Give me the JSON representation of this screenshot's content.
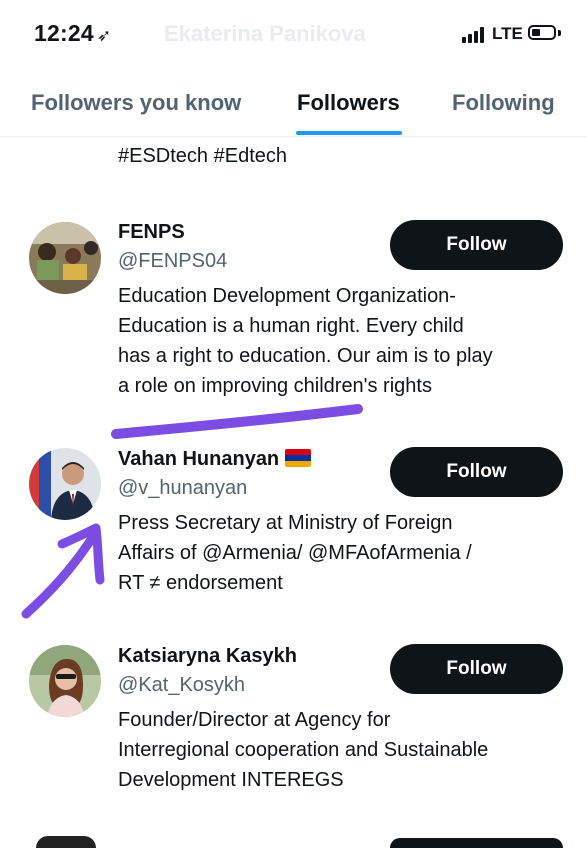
{
  "status_bar": {
    "time": "12:24",
    "location_glyph": "➶",
    "network": "LTE",
    "header_faded_title": "Ekaterina Panikova"
  },
  "tabs": [
    {
      "label": "Followers you know",
      "active": false
    },
    {
      "label": "Followers",
      "active": true
    },
    {
      "label": "Following",
      "active": false
    }
  ],
  "accent_color": "#1d9bf0",
  "annotation_color": "#7b4de3",
  "partial_bio": "#ESDtech #Edtech",
  "users": [
    {
      "name": "FENPS",
      "handle": "@FENPS04",
      "button": "Follow",
      "bio_lines": [
        "Education Development Organization-",
        "Education is a human right. Every child",
        "has a right to education. Our aim is to play",
        "a role on improving children's rights"
      ]
    },
    {
      "name": "Vahan Hunanyan",
      "flag": "armenia-flag",
      "handle": "@v_hunanyan",
      "button": "Follow",
      "bio_lines": [
        "Press Secretary at Ministry of Foreign",
        "Affairs of @Armenia/ @MFAofArmenia /",
        "RT ≠ endorsement"
      ]
    },
    {
      "name": "Katsiaryna Kasykh",
      "handle": "@Kat_Kosykh",
      "button": "Follow",
      "bio_lines": [
        "Founder/Director at Agency for",
        "Interregional cooperation and Sustainable",
        "Development INTEREGS"
      ]
    }
  ]
}
